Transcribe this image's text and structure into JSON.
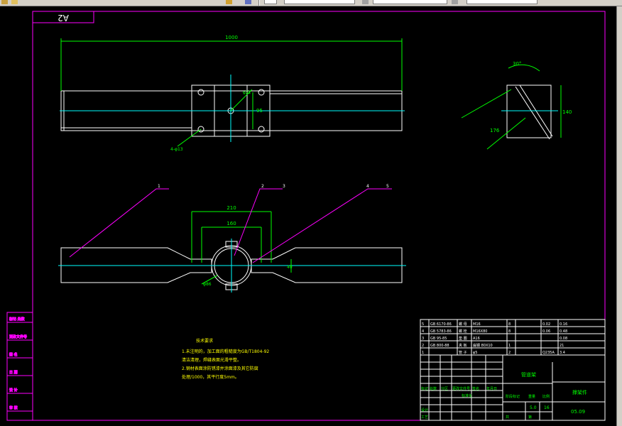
{
  "toolbar": {
    "layer_value": "",
    "linetype_value": "",
    "lineweight_value": ""
  },
  "drawing": {
    "sheet_code": "A2",
    "dims": {
      "top_length": "1000",
      "bolt_spacing": "95",
      "hole_note": "4-φ13",
      "center_hole": "φ22",
      "side_angle": "30°",
      "side_height": "140",
      "side_diag": "176",
      "front_outer": "210",
      "front_inner": "160",
      "front_dia": "φ86",
      "front_small": "40"
    },
    "balloons": [
      "1",
      "2",
      "3",
      "4",
      "5"
    ],
    "notes_title": "技术要求",
    "notes_lines": [
      "1.未注明的，加工面的粗糙度为GB/T1804-92",
      "  清洁清理，焊缝表面光滑平整。",
      "2.钢材表面涂防锈漆并涂面漆及其它防腐",
      "  处理/1000，其平行度5mm。"
    ],
    "left_strip": [
      "标记 处数",
      "更改文件号",
      "签 名",
      "日 期",
      "设 计",
      "审 核"
    ],
    "bom_rows": [
      {
        "no": "5",
        "code": "GB 6170-86",
        "name": "螺 母",
        "spec": "M16",
        "qty": "8",
        "weight": "0.02",
        "total": "0.16"
      },
      {
        "no": "4",
        "code": "GB 5783-86",
        "name": "螺 栓",
        "spec": "M16X80",
        "qty": "8",
        "weight": "0.06",
        "total": "0.48"
      },
      {
        "no": "3",
        "code": "GB 95-85",
        "name": "垫 圈",
        "spec": "A16",
        "qty": "",
        "weight": "",
        "total": "0.08"
      },
      {
        "no": "2",
        "code": "GB 800-88",
        "name": "夹 板",
        "spec": "扁钢 80X10",
        "qty": "1",
        "weight": "",
        "total": "21"
      },
      {
        "no": "1",
        "code": "",
        "name": "管 子",
        "spec": "φ5",
        "qty": "2",
        "weight": "Q235A",
        "total": "3.4"
      }
    ],
    "title_block": {
      "sheet_name": "管道架",
      "drawing_no": "05.09",
      "part": "撑架件",
      "scale": "5.0",
      "weight": "16",
      "row_headers": [
        "标记",
        "处数",
        "分区",
        "更改文件号",
        "签名",
        "年月日"
      ],
      "stage_label": "阶段标记",
      "weight_label": "重量",
      "scale_label": "比例",
      "std_label": "标准化",
      "design_label": "设计",
      "check_label": "审核",
      "craft_label": "工艺",
      "approve_label": "批准",
      "sheets_label": "共",
      "sheet_label": "第"
    }
  }
}
